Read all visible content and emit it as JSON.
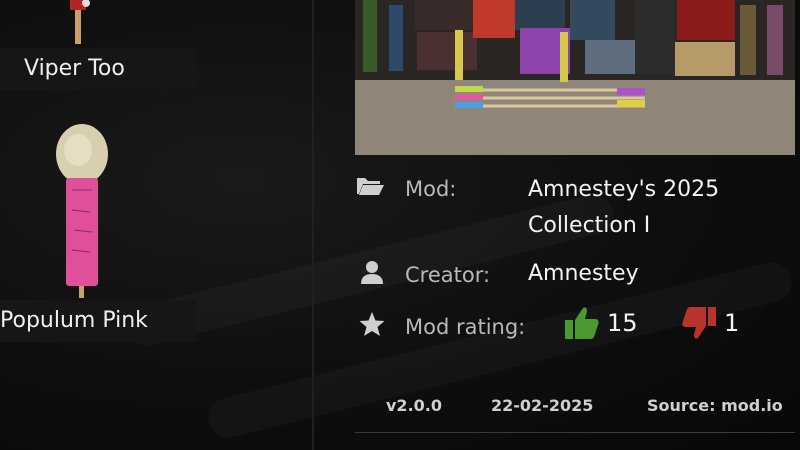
{
  "items": [
    {
      "label": "Viper Too"
    },
    {
      "label": "Populum Pink"
    }
  ],
  "details": {
    "mod_key": "Mod:",
    "mod_value_line1": "Amnestey's 2025",
    "mod_value_line2": "Collection I",
    "creator_key": "Creator:",
    "creator_value": "Amnestey",
    "rating_key": "Mod rating:",
    "likes": "15",
    "dislikes": "1"
  },
  "footer": {
    "version": "v2.0.0",
    "date": "22-02-2025",
    "source": "Source: mod.io"
  },
  "icons": {
    "mod": "folder-open-icon",
    "creator": "user-icon",
    "rating": "star-icon",
    "like": "thumbs-up-icon",
    "dislike": "thumbs-down-icon"
  },
  "colors": {
    "like": "#4a9a2f",
    "dislike": "#b8332c",
    "firework_pink": "#e0509a"
  }
}
